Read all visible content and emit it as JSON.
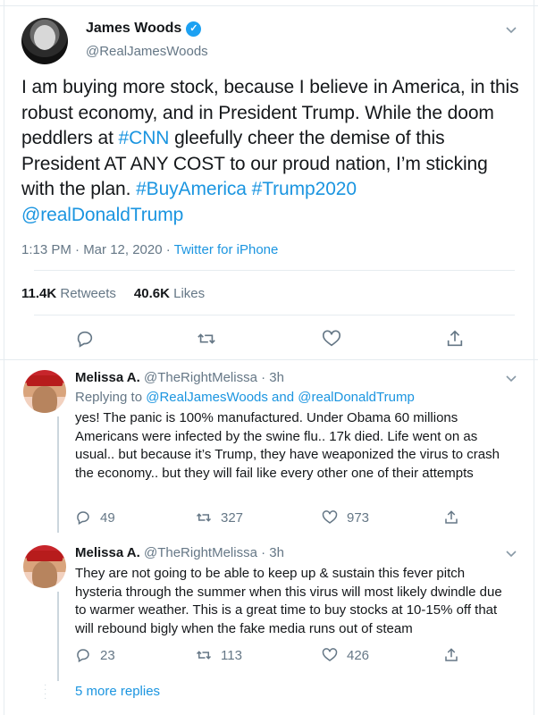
{
  "main_tweet": {
    "name": "James Woods",
    "handle": "@RealJamesWoods",
    "text_parts": {
      "p1": "I am buying more stock, because I believe in America, in this robust economy, and in President Trump. While the doom peddlers at ",
      "cnn": "#CNN",
      "p2": " gleefully cheer the demise of this President AT ANY COST to our proud nation, I’m sticking with the plan. ",
      "buyamerica": "#BuyAmerica",
      "trump2020": "#Trump2020",
      "mention": "@realDonaldTrump"
    },
    "time_date": "1:13 PM · Mar 12, 2020 · ",
    "source": "Twitter for iPhone",
    "retweets_count": "11.4K",
    "retweets_label": "Retweets",
    "likes_count": "40.6K",
    "likes_label": "Likes"
  },
  "replies": [
    {
      "name": "Melissa A.",
      "handle_time": "@TheRightMelissa · 3h",
      "replying_prefix": "Replying to ",
      "replying_to": "@RealJamesWoods and @realDonaldTrump",
      "text": "yes! The panic is 100% manufactured. Under Obama 60 millions Americans were infected by the swine flu.. 17k died. Life went on as usual.. but because it’s Trump, they have weaponized the virus to crash the economy.. but they will fail like every other one of their attempts",
      "replies_count": "49",
      "retweets_count": "327",
      "likes_count": "973"
    },
    {
      "name": "Melissa A.",
      "handle_time": "@TheRightMelissa · 3h",
      "text": "They are not going to be able to keep up & sustain this fever pitch hysteria through the summer when this virus will most likely dwindle due to warmer weather. This is a great time to buy stocks at 10-15% off that will rebound bigly when the fake media runs out of steam",
      "replies_count": "23",
      "retweets_count": "113",
      "likes_count": "426"
    }
  ],
  "more_replies": "5 more replies",
  "icons": [
    "verified-icon",
    "chevron-down-icon",
    "reply-icon",
    "retweet-icon",
    "like-icon",
    "share-icon"
  ],
  "colors": {
    "link": "#1b95e0",
    "verified": "#1da1f2",
    "muted": "#657786"
  }
}
